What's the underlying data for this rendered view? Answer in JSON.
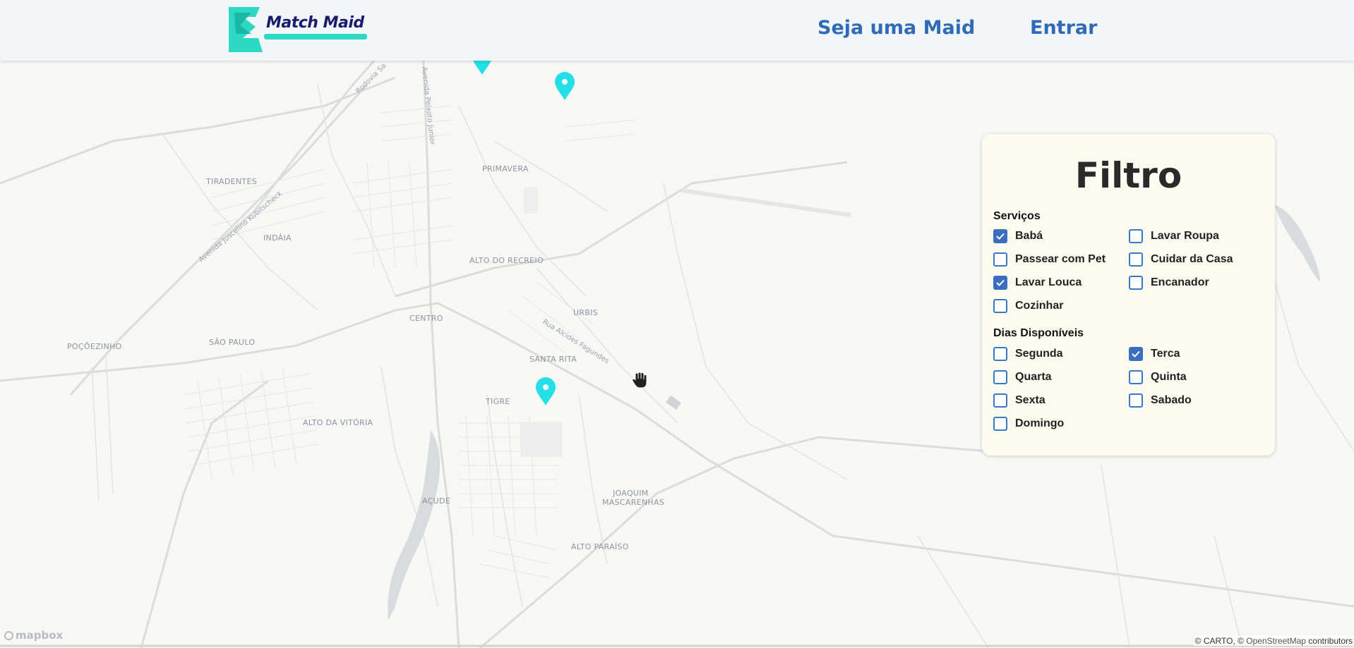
{
  "header": {
    "logo_text": "Match Maid",
    "nav": {
      "be_maid": "Seja uma Maid",
      "login": "Entrar"
    }
  },
  "map": {
    "neighborhoods": [
      "TIRADENTES",
      "PRIMAVERA",
      "INDÁIA",
      "ALTO DO RECREIO",
      "URBIS",
      "CENTRO",
      "POÇÕEZINHO",
      "SÃO PAULO",
      "SANTA RITA",
      "TIGRE",
      "ALTO DA VITÓRIA",
      "AÇUDE",
      "JOAQUIM",
      "MASCARENHAS",
      "ALTO PARAÍSO"
    ],
    "streets": [
      "Avenida Juscelino Kubitscheck",
      "Avenida Peixoto Junior",
      "Rodovia Sa",
      "Rua Alcides Fagundes"
    ],
    "marker_color": "#22e0e6"
  },
  "filter": {
    "title": "Filtro",
    "services_title": "Serviços",
    "services": [
      {
        "label": "Babá",
        "checked": true
      },
      {
        "label": "Lavar Roupa",
        "checked": false
      },
      {
        "label": "Passear com Pet",
        "checked": false
      },
      {
        "label": "Cuidar da Casa",
        "checked": false
      },
      {
        "label": "Lavar Louca",
        "checked": true
      },
      {
        "label": "Encanador",
        "checked": false
      },
      {
        "label": "Cozinhar",
        "checked": false
      }
    ],
    "days_title": "Dias Disponíveis",
    "days": [
      {
        "label": "Segunda",
        "checked": false
      },
      {
        "label": "Terca",
        "checked": true
      },
      {
        "label": "Quarta",
        "checked": false
      },
      {
        "label": "Quinta",
        "checked": false
      },
      {
        "label": "Sexta",
        "checked": false
      },
      {
        "label": "Sabado",
        "checked": false
      },
      {
        "label": "Domingo",
        "checked": false
      }
    ]
  },
  "footer": {
    "mapbox": "mapbox",
    "attribution_prefix": "© CARTO, © ",
    "attribution_osm": "OpenStreetMap",
    "attribution_suffix": " contributors"
  },
  "colors": {
    "nav": "#2f6bb6",
    "checkbox": "#3a6fbf",
    "panel_bg": "#fcfdf0"
  }
}
